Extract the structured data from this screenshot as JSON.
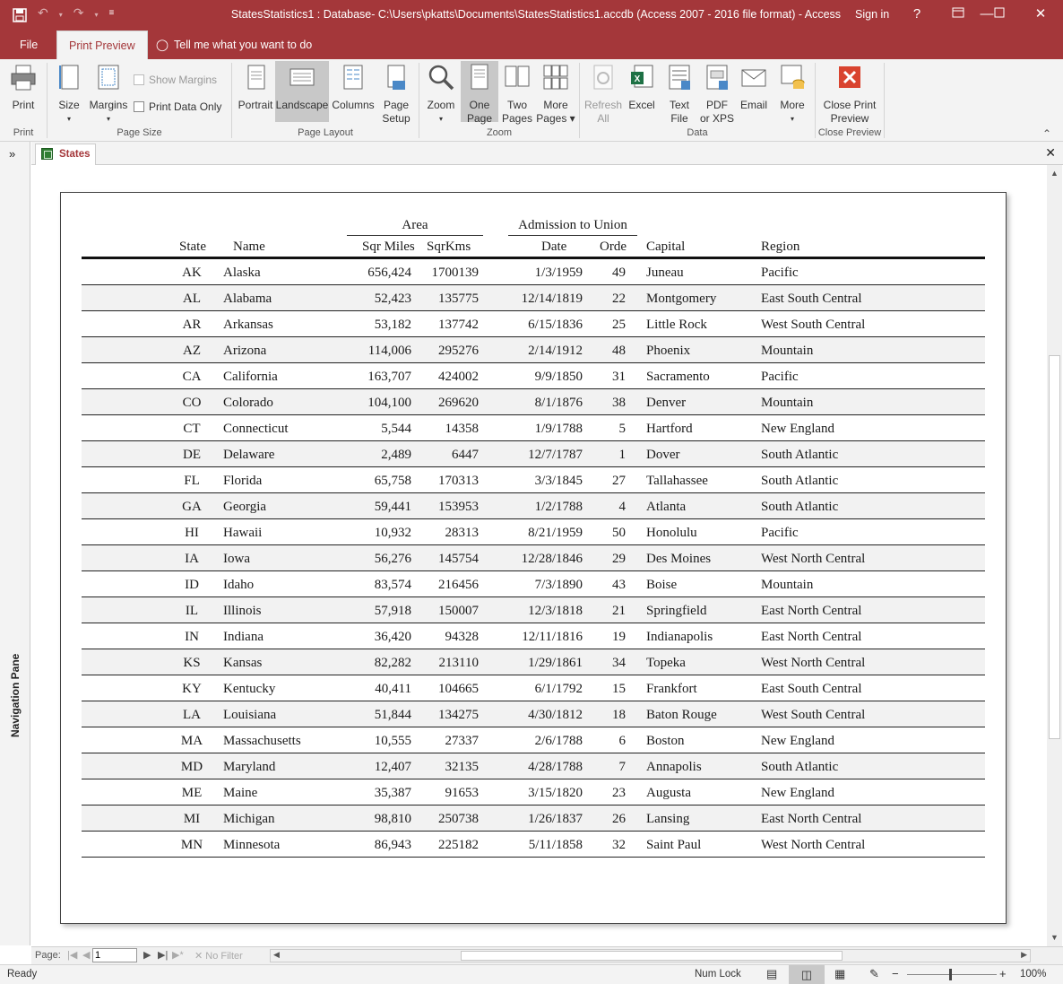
{
  "window": {
    "title": "StatesStatistics1 : Database- C:\\Users\\pkatts\\Documents\\StatesStatistics1.accdb (Access 2007 - 2016 file format) - Access",
    "sign_in": "Sign in",
    "help": "?"
  },
  "ribbon_tabs": {
    "file": "File",
    "print_preview": "Print Preview",
    "tell_me": "Tell me what you want to do"
  },
  "ribbon": {
    "print": "Print",
    "size": "Size",
    "margins": "Margins",
    "show_margins": "Show Margins",
    "print_data_only": "Print Data Only",
    "portrait": "Portrait",
    "landscape": "Landscape",
    "columns": "Columns",
    "page_setup_1": "Page",
    "page_setup_2": "Setup",
    "zoom": "Zoom",
    "one_page_1": "One",
    "one_page_2": "Page",
    "two_pages_1": "Two",
    "two_pages_2": "Pages",
    "more_pages_1": "More",
    "more_pages_2": "Pages",
    "refresh_1": "Refresh",
    "refresh_2": "All",
    "excel": "Excel",
    "text_file_1": "Text",
    "text_file_2": "File",
    "pdf_1": "PDF",
    "pdf_2": "or XPS",
    "email": "Email",
    "more": "More",
    "close_1": "Close Print",
    "close_2": "Preview",
    "groups": {
      "print": "Print",
      "page_size": "Page Size",
      "page_layout": "Page Layout",
      "zoom": "Zoom",
      "data": "Data",
      "close_preview": "Close Preview"
    }
  },
  "nav_pane_label": "Navigation Pane",
  "doc_tab": "States",
  "report": {
    "group_headers": {
      "area": "Area",
      "admission": "Admission to Union"
    },
    "columns": {
      "state": "State",
      "name": "Name",
      "sqr_miles": "Sqr Miles",
      "sqr_kms": "SqrKms",
      "date": "Date",
      "order": "Orde",
      "capital": "Capital",
      "region": "Region"
    },
    "rows": [
      [
        "AK",
        "Alaska",
        "656,424",
        "1700139",
        "1/3/1959",
        "49",
        "Juneau",
        "Pacific"
      ],
      [
        "AL",
        "Alabama",
        "52,423",
        "135775",
        "12/14/1819",
        "22",
        "Montgomery",
        "East South Central"
      ],
      [
        "AR",
        "Arkansas",
        "53,182",
        "137742",
        "6/15/1836",
        "25",
        "Little Rock",
        "West South Central"
      ],
      [
        "AZ",
        "Arizona",
        "114,006",
        "295276",
        "2/14/1912",
        "48",
        "Phoenix",
        "Mountain"
      ],
      [
        "CA",
        "California",
        "163,707",
        "424002",
        "9/9/1850",
        "31",
        "Sacramento",
        "Pacific"
      ],
      [
        "CO",
        "Colorado",
        "104,100",
        "269620",
        "8/1/1876",
        "38",
        "Denver",
        "Mountain"
      ],
      [
        "CT",
        "Connecticut",
        "5,544",
        "14358",
        "1/9/1788",
        "5",
        "Hartford",
        "New England"
      ],
      [
        "DE",
        "Delaware",
        "2,489",
        "6447",
        "12/7/1787",
        "1",
        "Dover",
        "South Atlantic"
      ],
      [
        "FL",
        "Florida",
        "65,758",
        "170313",
        "3/3/1845",
        "27",
        "Tallahassee",
        "South Atlantic"
      ],
      [
        "GA",
        "Georgia",
        "59,441",
        "153953",
        "1/2/1788",
        "4",
        "Atlanta",
        "South Atlantic"
      ],
      [
        "HI",
        "Hawaii",
        "10,932",
        "28313",
        "8/21/1959",
        "50",
        "Honolulu",
        "Pacific"
      ],
      [
        "IA",
        "Iowa",
        "56,276",
        "145754",
        "12/28/1846",
        "29",
        "Des Moines",
        "West North Central"
      ],
      [
        "ID",
        "Idaho",
        "83,574",
        "216456",
        "7/3/1890",
        "43",
        "Boise",
        "Mountain"
      ],
      [
        "IL",
        "Illinois",
        "57,918",
        "150007",
        "12/3/1818",
        "21",
        "Springfield",
        "East North Central"
      ],
      [
        "IN",
        "Indiana",
        "36,420",
        "94328",
        "12/11/1816",
        "19",
        "Indianapolis",
        "East North Central"
      ],
      [
        "KS",
        "Kansas",
        "82,282",
        "213110",
        "1/29/1861",
        "34",
        "Topeka",
        "West North Central"
      ],
      [
        "KY",
        "Kentucky",
        "40,411",
        "104665",
        "6/1/1792",
        "15",
        "Frankfort",
        "East South Central"
      ],
      [
        "LA",
        "Louisiana",
        "51,844",
        "134275",
        "4/30/1812",
        "18",
        "Baton Rouge",
        "West South Central"
      ],
      [
        "MA",
        "Massachusetts",
        "10,555",
        "27337",
        "2/6/1788",
        "6",
        "Boston",
        "New England"
      ],
      [
        "MD",
        "Maryland",
        "12,407",
        "32135",
        "4/28/1788",
        "7",
        "Annapolis",
        "South Atlantic"
      ],
      [
        "ME",
        "Maine",
        "35,387",
        "91653",
        "3/15/1820",
        "23",
        "Augusta",
        "New England"
      ],
      [
        "MI",
        "Michigan",
        "98,810",
        "250738",
        "1/26/1837",
        "26",
        "Lansing",
        "East North Central"
      ],
      [
        "MN",
        "Minnesota",
        "86,943",
        "225182",
        "5/11/1858",
        "32",
        "Saint Paul",
        "West North Central"
      ]
    ]
  },
  "record_nav": {
    "page_label": "Page:",
    "page_value": "1",
    "no_filter": "No Filter"
  },
  "status": {
    "ready": "Ready",
    "num_lock": "Num Lock",
    "zoom": "100%"
  },
  "colors": {
    "accent": "#a4373a",
    "ribbon_bg": "#f3f3f3",
    "selected_btn": "#c8c8c8"
  }
}
